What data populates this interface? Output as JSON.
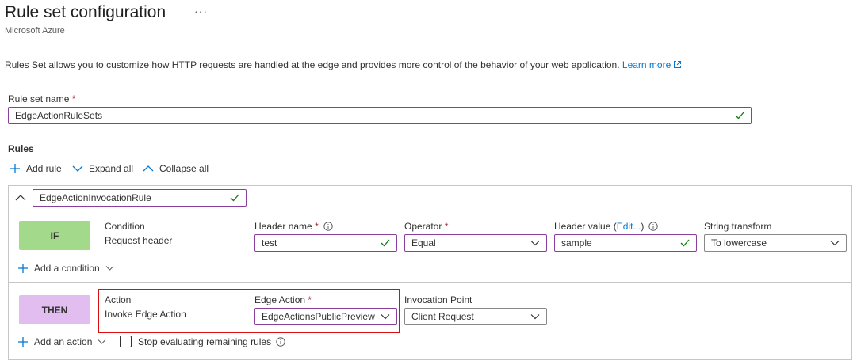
{
  "header": {
    "title": "Rule set configuration",
    "more_glyph": "···",
    "subtitle": "Microsoft Azure"
  },
  "description": {
    "text": "Rules Set allows you to customize how HTTP requests are handled at the edge and provides more control of the behavior of your web application.",
    "link": "Learn more"
  },
  "rule_set_name": {
    "label": "Rule set name",
    "required_mark": "*",
    "value": "EdgeActionRuleSets"
  },
  "rules": {
    "heading": "Rules",
    "commands": {
      "add_rule": "Add rule",
      "expand_all": "Expand all",
      "collapse_all": "Collapse all"
    },
    "rule": {
      "name": "EdgeActionInvocationRule",
      "condition": {
        "badge": "IF",
        "label": "Condition",
        "value": "Request header",
        "header_name": {
          "label": "Header name",
          "required_mark": "*",
          "value": "test"
        },
        "operator": {
          "label": "Operator",
          "required_mark": "*",
          "value": "Equal"
        },
        "header_value": {
          "label_prefix": "Header value (",
          "edit_link": "Edit...",
          "label_suffix": ")",
          "value": "sample"
        },
        "string_transform": {
          "label": "String transform",
          "value": "To lowercase"
        },
        "add_condition": "Add a condition"
      },
      "action": {
        "badge": "THEN",
        "label": "Action",
        "value": "Invoke Edge Action",
        "edge_action": {
          "label": "Edge Action",
          "required_mark": "*",
          "value": "EdgeActionsPublicPreview"
        },
        "invocation_point": {
          "label": "Invocation Point",
          "value": "Client Request"
        },
        "add_action": "Add an action",
        "stop_evaluating": "Stop evaluating remaining rules"
      }
    }
  },
  "icons": {
    "external_link": "external-link-icon",
    "info": "info-icon",
    "check": "checkmark-icon",
    "chevron": "chevron-down-icon",
    "plus": "plus-icon"
  },
  "colors": {
    "accent": "#0078d4",
    "field_border": "#8a3f9c",
    "valid_check": "#107c10",
    "if_badge": "#a3d98a",
    "then_badge": "#e2bdf0",
    "highlight": "#d90f0f",
    "required": "#a4262c"
  }
}
